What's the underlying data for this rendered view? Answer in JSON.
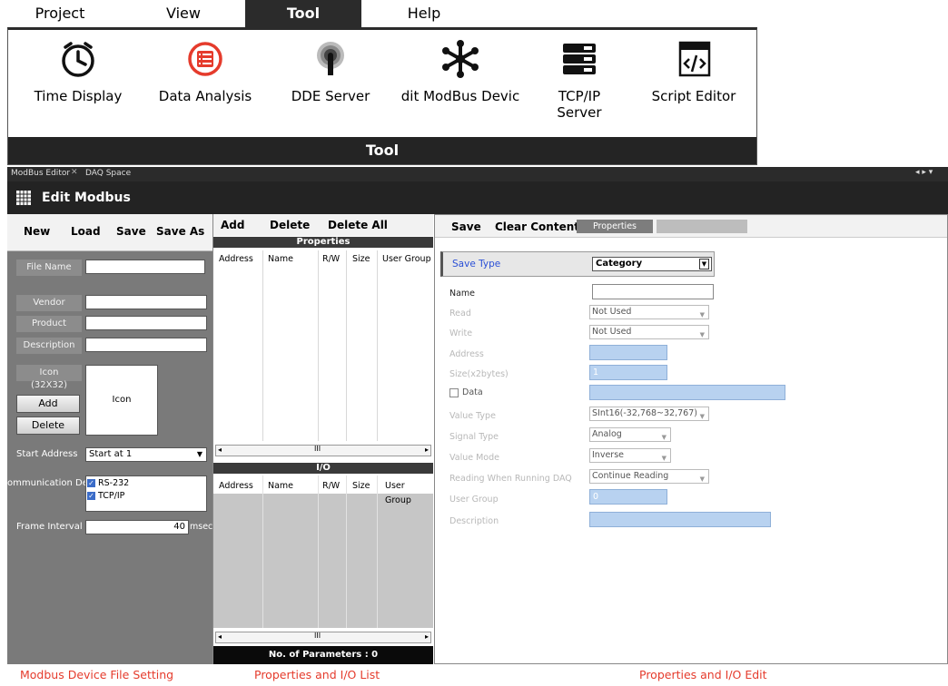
{
  "menu": {
    "project": "Project",
    "view": "View",
    "tool": "Tool",
    "help": "Help"
  },
  "ribbon": {
    "buttons": [
      {
        "label": "Time Display",
        "icon": "clock-icon"
      },
      {
        "label": "Data Analysis",
        "icon": "data-list-icon"
      },
      {
        "label": "DDE Server",
        "icon": "dde-antenna-icon"
      },
      {
        "label": "dit ModBus Devic",
        "icon": "modbus-network-icon"
      },
      {
        "label_line1": "TCP/IP",
        "label_line2": "Server",
        "icon": "server-icon"
      },
      {
        "label": "Script Editor",
        "icon": "script-editor-icon"
      }
    ],
    "group": "Tool"
  },
  "tabs": {
    "modbus_editor": "ModBus Editor",
    "close": "✕",
    "daq_space": "DAQ Space",
    "nav": "◂ ▸ ▾"
  },
  "title": "Edit Modbus",
  "left": {
    "toolbar": {
      "new": "New",
      "load": "Load",
      "save": "Save",
      "save_as": "Save As"
    },
    "file_name": "File Name",
    "vendor": "Vendor",
    "product": "Product",
    "description": "Description",
    "icon_label": "Icon",
    "icon_size": "(32X32)",
    "add": "Add",
    "delete": "Delete",
    "icon_preview": "Icon",
    "start_address": "Start Address",
    "start_address_value": "Start at 1",
    "comm_device": "ommunication Devi",
    "comm_options": [
      {
        "label": "RS-232",
        "checked": true
      },
      {
        "label": "TCP/IP",
        "checked": true
      }
    ],
    "frame_interval": "Frame Interval",
    "frame_interval_value": "40",
    "frame_unit": "msec"
  },
  "middle": {
    "toolbar": {
      "add": "Add",
      "delete": "Delete",
      "delete_all": "Delete All"
    },
    "properties_title": "Properties",
    "columns": [
      "Address",
      "Name",
      "R/W",
      "Size",
      "User Group"
    ],
    "io_title": "I/O",
    "scroll_mark": "III",
    "footer": "No. of Parameters : 0"
  },
  "right": {
    "toolbar": {
      "save": "Save",
      "clear": "Clear Contents",
      "tab": "Properties"
    },
    "save_type": "Save Type",
    "save_type_value": "Category",
    "name": "Name",
    "read": "Read",
    "read_value": "Not Used",
    "write": "Write",
    "write_value": "Not Used",
    "address": "Address",
    "size": "Size(x2bytes)",
    "size_value": "1",
    "data": "Data",
    "value_type": "Value Type",
    "value_type_value": "SInt16(-32,768~32,767)",
    "signal_type": "Signal Type",
    "signal_type_value": "Analog",
    "value_mode": "Value Mode",
    "value_mode_value": "Inverse",
    "reading": "Reading When Running DAQ",
    "reading_value": "Continue Reading",
    "user_group": "User Group",
    "user_group_value": "0",
    "description": "Description"
  },
  "captions": {
    "left": "Modbus Device File Setting",
    "middle": "Properties and I/O List",
    "right": "Properties and I/O Edit"
  },
  "colors": {
    "accent_red": "#e53b2c",
    "dark": "#2b2b2b",
    "field_blue": "#b8d2f0",
    "save_type_text": "#2a4fd6"
  }
}
